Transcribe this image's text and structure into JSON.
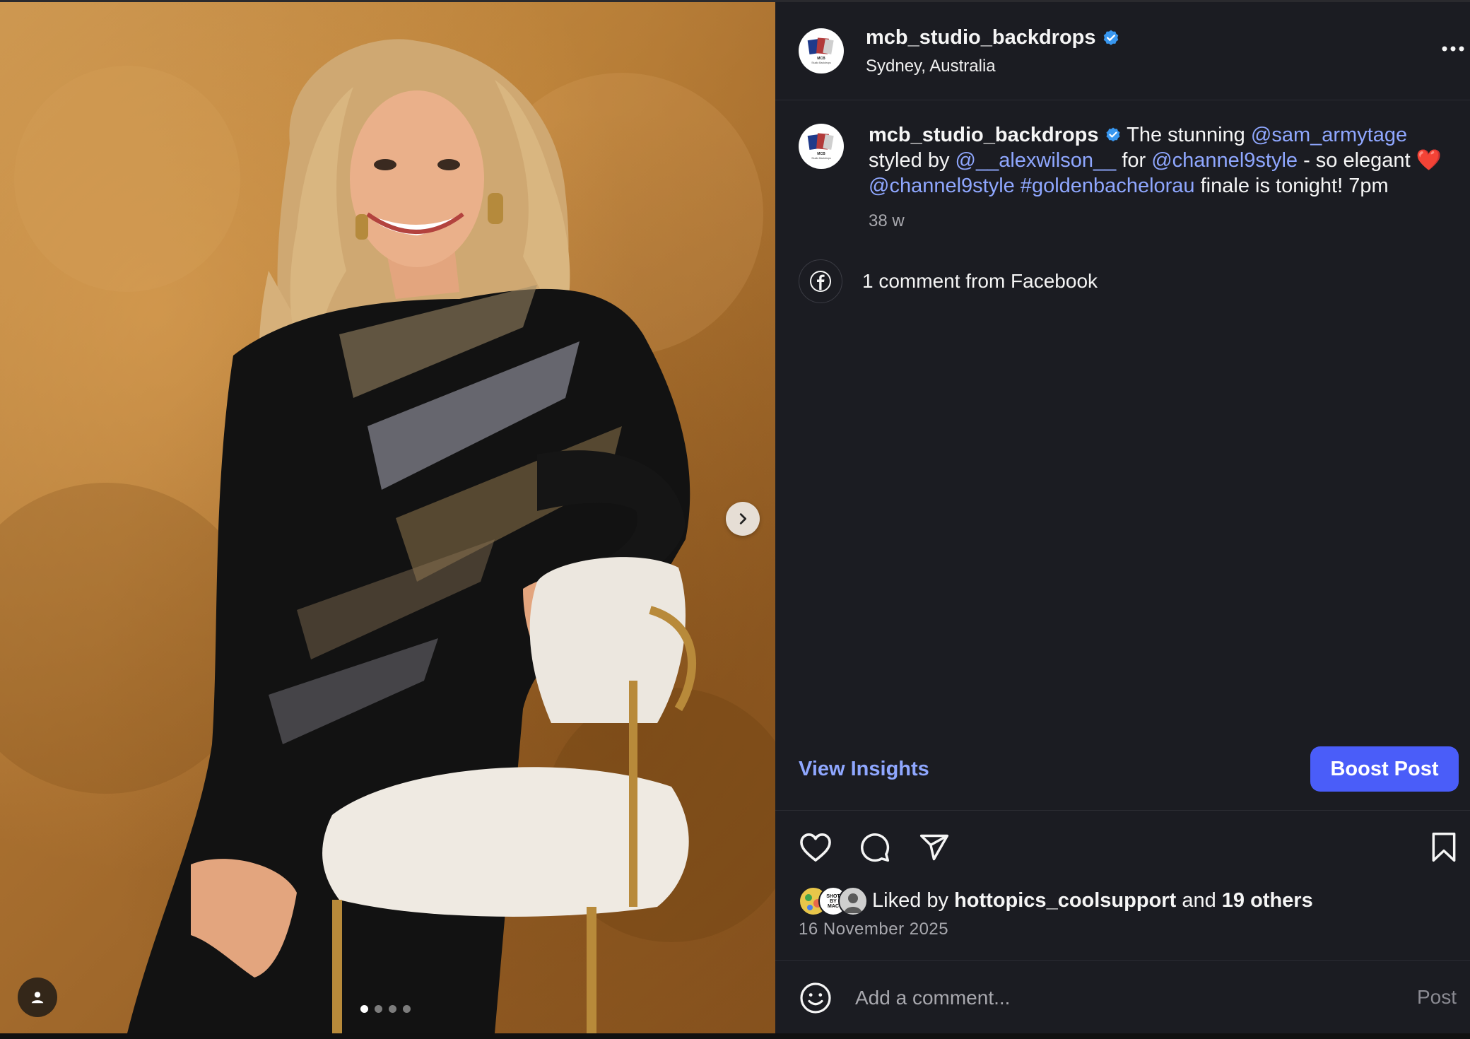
{
  "media": {
    "carousel_dots": 4,
    "active_dot": 1,
    "next_icon": "chevron-right-icon",
    "tag_icon": "person-icon"
  },
  "header": {
    "username": "mcb_studio_backdrops",
    "location": "Sydney, Australia",
    "verified_icon": "verified-badge-icon",
    "more_icon": "more-horizontal-icon"
  },
  "caption": {
    "username": "mcb_studio_backdrops",
    "text_1": "The stunning",
    "mention_1": "@sam_armytage",
    "text_2": "styled by",
    "mention_2": "@__alexwilson__",
    "text_3": "for",
    "mention_3": "@channel9style",
    "text_4": "- so elegant",
    "emoji": "❤️",
    "mention_4": "@channel9style",
    "hashtag": "#goldenbachelorau",
    "text_5": "finale is tonight! 7pm",
    "time": "38 w"
  },
  "facebook": {
    "text": "1 comment from Facebook",
    "icon": "facebook-icon"
  },
  "insights_label": "View Insights",
  "boost_label": "Boost Post",
  "actions": {
    "like_icon": "heart-icon",
    "comment_icon": "comment-icon",
    "share_icon": "send-icon",
    "save_icon": "bookmark-icon"
  },
  "likes": {
    "prefix": "Liked by",
    "user": "hottopics_coolsupport",
    "middle": "and",
    "others": "19 others",
    "avatar_2_text": "SHOT BY MAC"
  },
  "date": "16 November 2025",
  "comment": {
    "placeholder": "Add a comment...",
    "post_label": "Post",
    "emoji_icon": "smiley-icon"
  },
  "colors": {
    "accent": "#4a5df9",
    "link": "#8fa7ff",
    "verified": "#3897f0",
    "panel_bg": "#1b1c22"
  }
}
